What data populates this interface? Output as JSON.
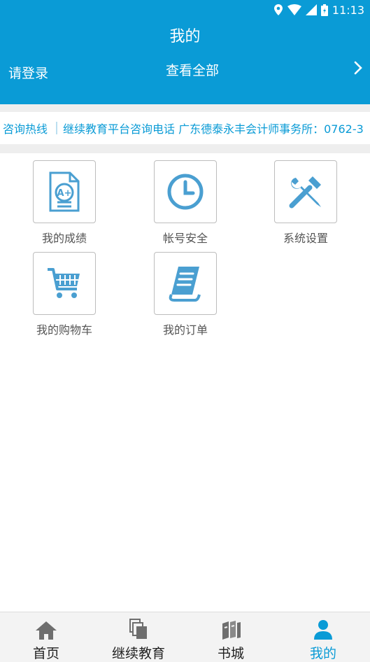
{
  "status_bar": {
    "time": "11:13"
  },
  "header": {
    "title": "我的",
    "login_label": "请登录",
    "view_all_label": "查看全部"
  },
  "hotline": {
    "label": "咨询热线",
    "text": "继续教育平台咨询电话 广东德泰永丰会计师事务所：0762-3"
  },
  "grid": {
    "items": [
      {
        "label": "我的成绩",
        "icon": "grade-icon"
      },
      {
        "label": "帐号安全",
        "icon": "clock-icon"
      },
      {
        "label": "系统设置",
        "icon": "tools-icon"
      },
      {
        "label": "我的购物车",
        "icon": "cart-icon"
      },
      {
        "label": "我的订单",
        "icon": "order-icon"
      }
    ]
  },
  "bottom_nav": {
    "items": [
      {
        "label": "首页",
        "icon": "home-icon"
      },
      {
        "label": "继续教育",
        "icon": "courses-icon"
      },
      {
        "label": "书城",
        "icon": "books-icon"
      },
      {
        "label": "我的",
        "icon": "user-icon",
        "active": true
      }
    ]
  },
  "colors": {
    "primary": "#0a9bd6",
    "icon_blue": "#4a9fd1",
    "divider": "#eeeeee",
    "nav_inactive_icon": "#6e6e6e"
  }
}
